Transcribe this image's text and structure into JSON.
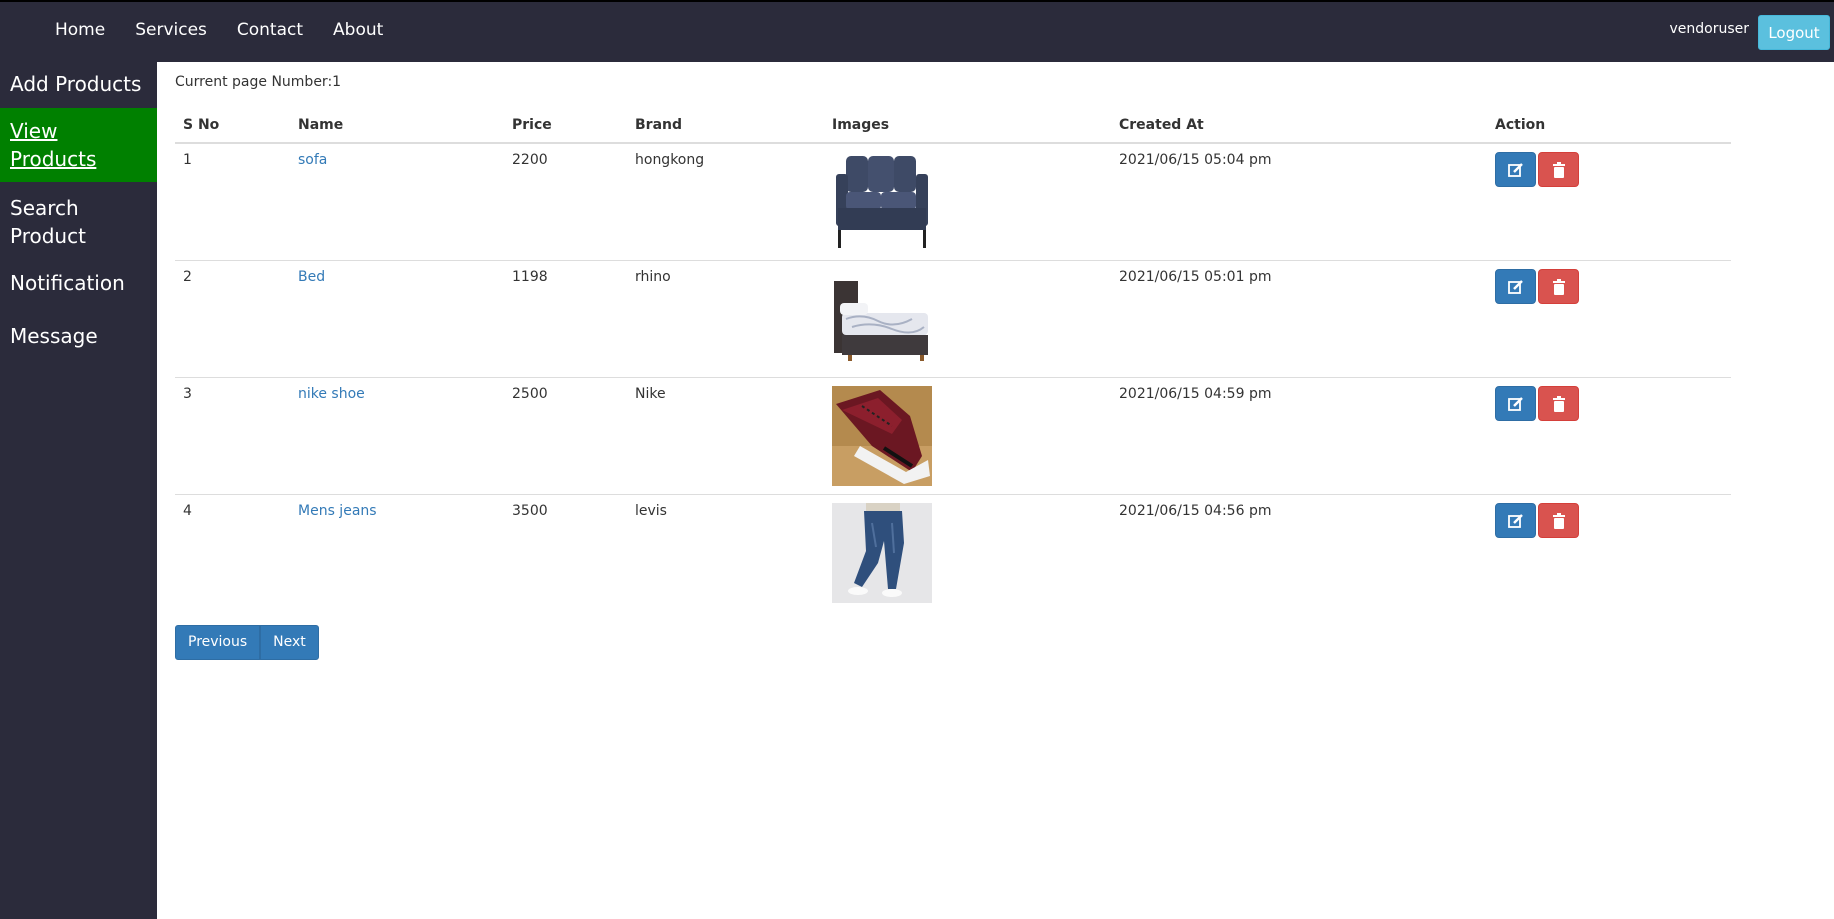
{
  "nav": {
    "items": [
      "Home",
      "Services",
      "Contact",
      "About"
    ],
    "username": "vendoruser",
    "logout_label": "Logout"
  },
  "sidebar": {
    "items": [
      {
        "label": "Add Products",
        "active": false
      },
      {
        "label": "View Products",
        "active": true
      },
      {
        "label": "Search Product",
        "active": false
      },
      {
        "label": "Notification",
        "active": false
      },
      {
        "label": "Message",
        "active": false
      }
    ]
  },
  "page": {
    "current_page_text": "Current page Number:1"
  },
  "table": {
    "headers": [
      "S No",
      "Name",
      "Price",
      "Brand",
      "Images",
      "Created At",
      "Action"
    ],
    "rows": [
      {
        "sno": "1",
        "name": "sofa",
        "price": "2200",
        "brand": "hongkong",
        "image": "sofa-image",
        "created": "2021/06/15 05:04 pm"
      },
      {
        "sno": "2",
        "name": "Bed",
        "price": "1198",
        "brand": "rhino",
        "image": "bed-image",
        "created": "2021/06/15 05:01 pm"
      },
      {
        "sno": "3",
        "name": "nike shoe",
        "price": "2500",
        "brand": "Nike",
        "image": "shoe-image",
        "created": "2021/06/15 04:59 pm"
      },
      {
        "sno": "4",
        "name": "Mens jeans",
        "price": "3500",
        "brand": "levis",
        "image": "jeans-image",
        "created": "2021/06/15 04:56 pm"
      }
    ]
  },
  "pager": {
    "previous_label": "Previous",
    "next_label": "Next"
  },
  "colors": {
    "nav_bg": "#2b2b3b",
    "active_bg": "#008000",
    "primary": "#337ab7",
    "danger": "#d9534f",
    "info": "#5bc0de"
  }
}
